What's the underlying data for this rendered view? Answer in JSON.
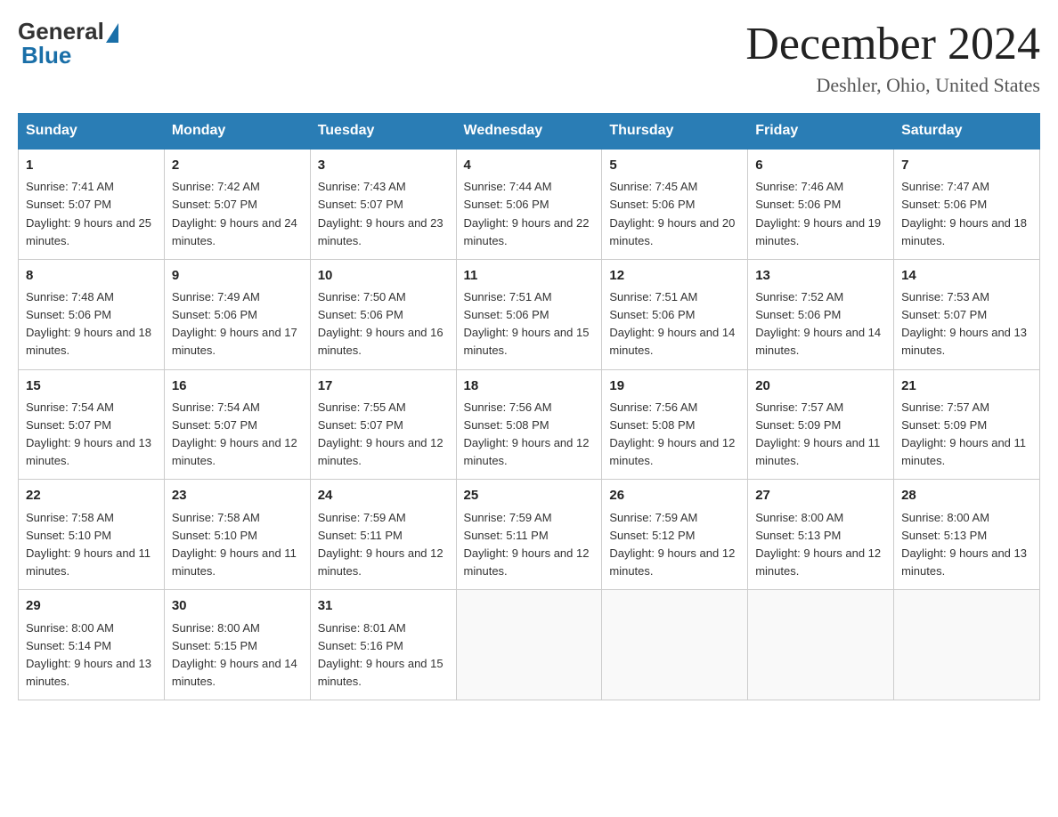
{
  "logo": {
    "general": "General",
    "blue": "Blue"
  },
  "title": "December 2024",
  "location": "Deshler, Ohio, United States",
  "days_of_week": [
    "Sunday",
    "Monday",
    "Tuesday",
    "Wednesday",
    "Thursday",
    "Friday",
    "Saturday"
  ],
  "weeks": [
    [
      {
        "day": 1,
        "sunrise": "7:41 AM",
        "sunset": "5:07 PM",
        "daylight": "9 hours and 25 minutes."
      },
      {
        "day": 2,
        "sunrise": "7:42 AM",
        "sunset": "5:07 PM",
        "daylight": "9 hours and 24 minutes."
      },
      {
        "day": 3,
        "sunrise": "7:43 AM",
        "sunset": "5:07 PM",
        "daylight": "9 hours and 23 minutes."
      },
      {
        "day": 4,
        "sunrise": "7:44 AM",
        "sunset": "5:06 PM",
        "daylight": "9 hours and 22 minutes."
      },
      {
        "day": 5,
        "sunrise": "7:45 AM",
        "sunset": "5:06 PM",
        "daylight": "9 hours and 20 minutes."
      },
      {
        "day": 6,
        "sunrise": "7:46 AM",
        "sunset": "5:06 PM",
        "daylight": "9 hours and 19 minutes."
      },
      {
        "day": 7,
        "sunrise": "7:47 AM",
        "sunset": "5:06 PM",
        "daylight": "9 hours and 18 minutes."
      }
    ],
    [
      {
        "day": 8,
        "sunrise": "7:48 AM",
        "sunset": "5:06 PM",
        "daylight": "9 hours and 18 minutes."
      },
      {
        "day": 9,
        "sunrise": "7:49 AM",
        "sunset": "5:06 PM",
        "daylight": "9 hours and 17 minutes."
      },
      {
        "day": 10,
        "sunrise": "7:50 AM",
        "sunset": "5:06 PM",
        "daylight": "9 hours and 16 minutes."
      },
      {
        "day": 11,
        "sunrise": "7:51 AM",
        "sunset": "5:06 PM",
        "daylight": "9 hours and 15 minutes."
      },
      {
        "day": 12,
        "sunrise": "7:51 AM",
        "sunset": "5:06 PM",
        "daylight": "9 hours and 14 minutes."
      },
      {
        "day": 13,
        "sunrise": "7:52 AM",
        "sunset": "5:06 PM",
        "daylight": "9 hours and 14 minutes."
      },
      {
        "day": 14,
        "sunrise": "7:53 AM",
        "sunset": "5:07 PM",
        "daylight": "9 hours and 13 minutes."
      }
    ],
    [
      {
        "day": 15,
        "sunrise": "7:54 AM",
        "sunset": "5:07 PM",
        "daylight": "9 hours and 13 minutes."
      },
      {
        "day": 16,
        "sunrise": "7:54 AM",
        "sunset": "5:07 PM",
        "daylight": "9 hours and 12 minutes."
      },
      {
        "day": 17,
        "sunrise": "7:55 AM",
        "sunset": "5:07 PM",
        "daylight": "9 hours and 12 minutes."
      },
      {
        "day": 18,
        "sunrise": "7:56 AM",
        "sunset": "5:08 PM",
        "daylight": "9 hours and 12 minutes."
      },
      {
        "day": 19,
        "sunrise": "7:56 AM",
        "sunset": "5:08 PM",
        "daylight": "9 hours and 12 minutes."
      },
      {
        "day": 20,
        "sunrise": "7:57 AM",
        "sunset": "5:09 PM",
        "daylight": "9 hours and 11 minutes."
      },
      {
        "day": 21,
        "sunrise": "7:57 AM",
        "sunset": "5:09 PM",
        "daylight": "9 hours and 11 minutes."
      }
    ],
    [
      {
        "day": 22,
        "sunrise": "7:58 AM",
        "sunset": "5:10 PM",
        "daylight": "9 hours and 11 minutes."
      },
      {
        "day": 23,
        "sunrise": "7:58 AM",
        "sunset": "5:10 PM",
        "daylight": "9 hours and 11 minutes."
      },
      {
        "day": 24,
        "sunrise": "7:59 AM",
        "sunset": "5:11 PM",
        "daylight": "9 hours and 12 minutes."
      },
      {
        "day": 25,
        "sunrise": "7:59 AM",
        "sunset": "5:11 PM",
        "daylight": "9 hours and 12 minutes."
      },
      {
        "day": 26,
        "sunrise": "7:59 AM",
        "sunset": "5:12 PM",
        "daylight": "9 hours and 12 minutes."
      },
      {
        "day": 27,
        "sunrise": "8:00 AM",
        "sunset": "5:13 PM",
        "daylight": "9 hours and 12 minutes."
      },
      {
        "day": 28,
        "sunrise": "8:00 AM",
        "sunset": "5:13 PM",
        "daylight": "9 hours and 13 minutes."
      }
    ],
    [
      {
        "day": 29,
        "sunrise": "8:00 AM",
        "sunset": "5:14 PM",
        "daylight": "9 hours and 13 minutes."
      },
      {
        "day": 30,
        "sunrise": "8:00 AM",
        "sunset": "5:15 PM",
        "daylight": "9 hours and 14 minutes."
      },
      {
        "day": 31,
        "sunrise": "8:01 AM",
        "sunset": "5:16 PM",
        "daylight": "9 hours and 15 minutes."
      },
      null,
      null,
      null,
      null
    ]
  ]
}
